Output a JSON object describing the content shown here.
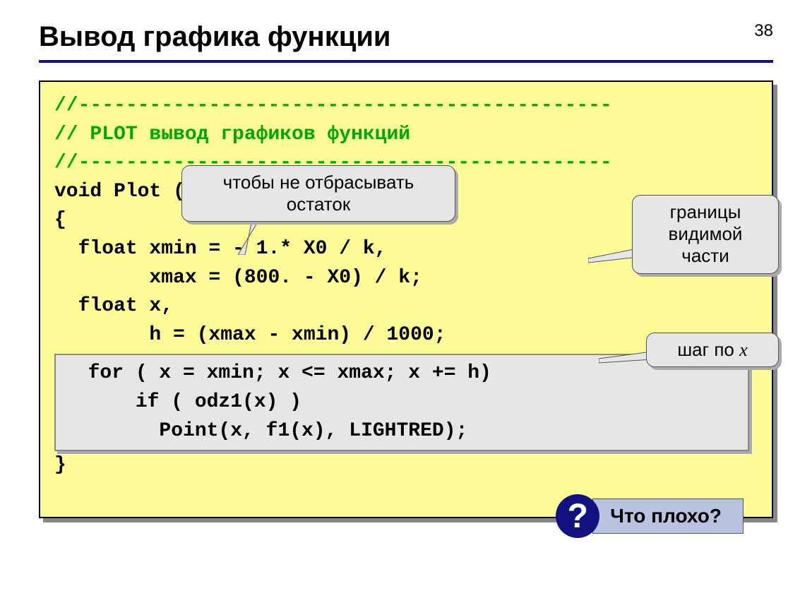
{
  "page_number": "38",
  "title": "Вывод графика функции",
  "code": {
    "c1": "//---------------------------------------------",
    "c2": "// PLOT вывод графиков функций",
    "c3": "//---------------------------------------------",
    "l1": "void Plot ()",
    "l2": "{",
    "l3": "  float xmin = - 1.* X0 / k,",
    "l4": "        xmax = (800. - X0) / k;",
    "l5": "  float x,",
    "l6": "        h = (xmax - xmin) / 1000;",
    "l_for": "  for ( x = xmin; x <= xmax; x += h)",
    "l_if": "      if ( odz1(x) )",
    "l_pt": "        Point(x, f1(x), LIGHTRED);",
    "l_end": "}"
  },
  "callouts": {
    "no_discard": "чтобы не отбрасывать остаток",
    "bounds": "границы видимой части",
    "step_prefix": "шаг по ",
    "step_var": "x"
  },
  "question": {
    "icon": "?",
    "label": "Что плохо?"
  }
}
